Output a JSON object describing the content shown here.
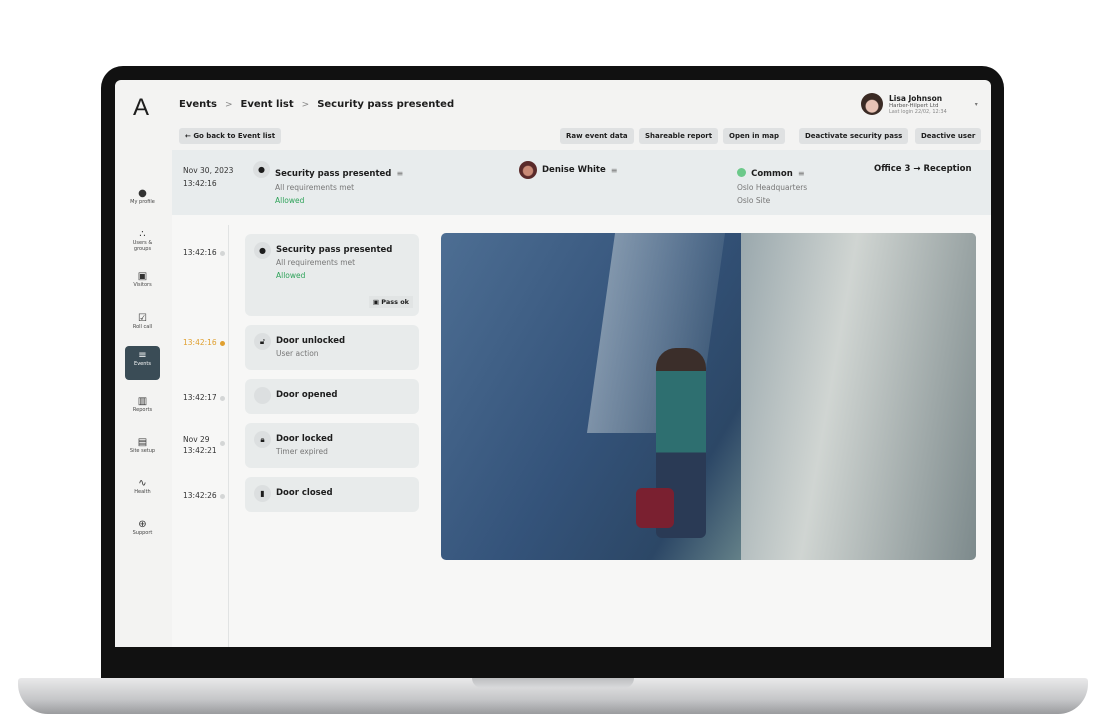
{
  "app": {
    "logo": "A"
  },
  "breadcrumb": [
    "Events",
    "Event list",
    "Security pass presented"
  ],
  "user": {
    "name": "Lisa Johnson",
    "company": "Harber-Hilpert Ltd",
    "last_login": "Last login 22/02, 12:34"
  },
  "toolbar": {
    "back": "Go back to Event list",
    "raw": "Raw event data",
    "share": "Shareable report",
    "map": "Open in map",
    "deactivate_pass": "Deactivate security pass",
    "deactivate_user": "Deactive user"
  },
  "sidebar": [
    {
      "label": "My profile",
      "icon": "user-icon"
    },
    {
      "label": "Users & groups",
      "icon": "users-icon"
    },
    {
      "label": "Visitors",
      "icon": "badge-icon"
    },
    {
      "label": "Roll call",
      "icon": "checklist-icon"
    },
    {
      "label": "Events",
      "icon": "events-icon",
      "active": true
    },
    {
      "label": "Reports",
      "icon": "chart-icon"
    },
    {
      "label": "Site setup",
      "icon": "building-icon"
    },
    {
      "label": "Health",
      "icon": "pulse-icon"
    },
    {
      "label": "Support",
      "icon": "lifebuoy-icon"
    }
  ],
  "summary": {
    "date": "Nov 30, 2023",
    "time": "13:42:16",
    "event": "Security pass presented",
    "detail": "All requirements met",
    "status": "Allowed",
    "person": "Denise White",
    "group": "Common",
    "site1": "Oslo Headquarters",
    "site2": "Oslo Site",
    "from": "Office 3",
    "to": "Reception"
  },
  "timeline": [
    {
      "time": "13:42:16",
      "title": "Security pass presented",
      "detail": "All requirements met",
      "status": "Allowed",
      "badge": "Pass ok"
    },
    {
      "time": "13:42:16",
      "title": "Door unlocked",
      "detail": "User action",
      "highlight": true
    },
    {
      "time": "13:42:17",
      "title": "Door opened"
    },
    {
      "date": "Nov 29",
      "time": "13:42:21",
      "title": "Door locked",
      "detail": "Timer expired"
    },
    {
      "time": "13:42:26",
      "title": "Door closed"
    }
  ],
  "colors": {
    "allowed": "#2fa35a",
    "highlight": "#e0a030",
    "active_nav": "#3a4c56",
    "group_dot": "#6cc98a"
  }
}
